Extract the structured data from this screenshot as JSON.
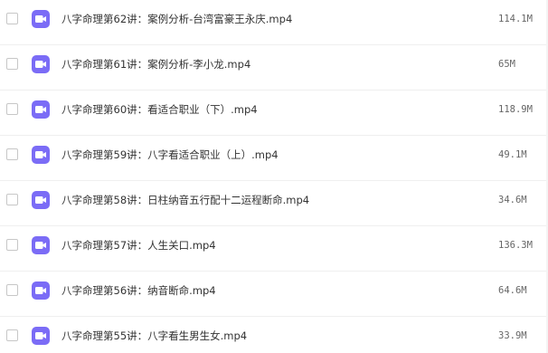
{
  "accent_color": "#7B6CF6",
  "files": [
    {
      "name": "八字命理第62讲：案例分析-台湾富豪王永庆.mp4",
      "size": "114.1M",
      "icon": "video-file-icon"
    },
    {
      "name": "八字命理第61讲：案例分析-李小龙.mp4",
      "size": "65M",
      "icon": "video-file-icon"
    },
    {
      "name": "八字命理第60讲：看适合职业（下）.mp4",
      "size": "118.9M",
      "icon": "video-file-icon"
    },
    {
      "name": "八字命理第59讲：八字看适合职业（上）.mp4",
      "size": "49.1M",
      "icon": "video-file-icon"
    },
    {
      "name": "八字命理第58讲：日柱纳音五行配十二运程断命.mp4",
      "size": "34.6M",
      "icon": "video-file-icon"
    },
    {
      "name": "八字命理第57讲：人生关口.mp4",
      "size": "136.3M",
      "icon": "video-file-icon"
    },
    {
      "name": "八字命理第56讲：纳音断命.mp4",
      "size": "64.6M",
      "icon": "video-file-icon"
    },
    {
      "name": "八字命理第55讲：八字看生男生女.mp4",
      "size": "33.9M",
      "icon": "video-file-icon"
    }
  ]
}
